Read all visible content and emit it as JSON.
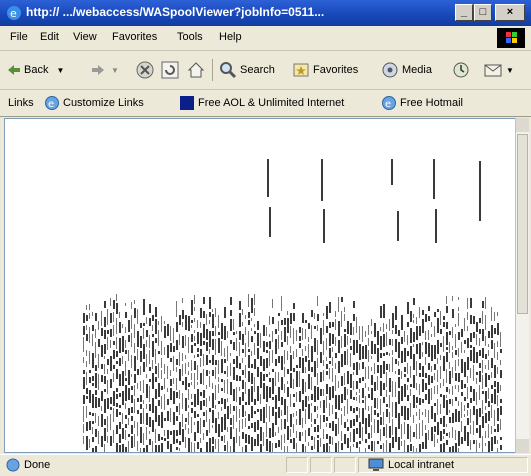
{
  "window": {
    "title": "http://          .../webaccess/WASpoolViewer?jobInfo=0511...",
    "buttons": {
      "minimize": "_",
      "maximize": "□",
      "close": "×"
    }
  },
  "menu": [
    "File",
    "Edit",
    "View",
    "Favorites",
    "Tools",
    "Help"
  ],
  "toolbar": {
    "back_label": "Back",
    "search_label": "Search",
    "favorites_label": "Favorites",
    "media_label": "Media"
  },
  "links": {
    "label": "Links",
    "items": [
      "Customize Links",
      "Free AOL & Unlimited Internet",
      "Free Hotmail"
    ]
  },
  "status": {
    "text": "Done",
    "zone": "Local intranet"
  },
  "colors": {
    "titlebar": "#1747b8",
    "chrome": "#ece9d8",
    "content_bg": "#ffffff"
  },
  "icons": [
    "ie-logo-icon",
    "back-arrow-icon",
    "forward-arrow-icon",
    "stop-icon",
    "refresh-icon",
    "home-icon",
    "search-icon",
    "favorites-icon",
    "media-icon",
    "history-icon",
    "mail-icon",
    "page-icon",
    "intranet-icon"
  ]
}
